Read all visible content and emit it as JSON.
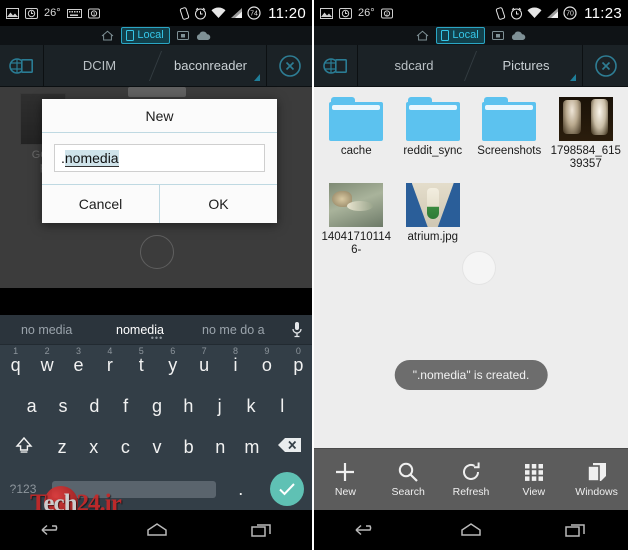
{
  "left_phone": {
    "status_bar": {
      "icons_left": [
        "gallery-icon",
        "camera-timer-icon",
        "keyboard-icon",
        "screenshot-icon"
      ],
      "temperature": "26°",
      "icons_right": [
        "vibrate-icon",
        "alarm-icon",
        "wifi-icon",
        "signal-icon",
        "battery-icon"
      ],
      "battery_level": "74",
      "time": "11:20"
    },
    "tabstrip": {
      "home_icon": "home-icon",
      "local_label": "Local",
      "lan_icon": "lan-icon",
      "cloud_icon": "cloud-icon"
    },
    "breadcrumb": {
      "menu_icon": "panel-toggle-icon",
      "crumbs": [
        "DCIM",
        "baconreader"
      ],
      "close_icon": "close-icon"
    },
    "background_item": {
      "label_line1": "GQs",
      "label_line2": "p"
    },
    "dialog": {
      "title": "New",
      "input_value": ".nomedia",
      "input_prefix": ".",
      "input_selected": "nomedia",
      "cancel_label": "Cancel",
      "ok_label": "OK"
    },
    "keyboard": {
      "suggestions": [
        "no media",
        "nomedia",
        "no me do a"
      ],
      "active_suggestion": "nomedia",
      "mic_icon": "microphone-icon",
      "row1": [
        {
          "key": "q",
          "num": "1"
        },
        {
          "key": "w",
          "num": "2"
        },
        {
          "key": "e",
          "num": "3"
        },
        {
          "key": "r",
          "num": "4"
        },
        {
          "key": "t",
          "num": "5"
        },
        {
          "key": "y",
          "num": "6"
        },
        {
          "key": "u",
          "num": "7"
        },
        {
          "key": "i",
          "num": "8"
        },
        {
          "key": "o",
          "num": "9"
        },
        {
          "key": "p",
          "num": "0"
        }
      ],
      "row2": [
        "a",
        "s",
        "d",
        "f",
        "g",
        "h",
        "j",
        "k",
        "l"
      ],
      "row3": [
        "z",
        "x",
        "c",
        "v",
        "b",
        "n",
        "m"
      ],
      "shift_icon": "shift-icon",
      "backspace_icon": "backspace-icon",
      "symbols_label": "?123",
      "period_label": ".",
      "enter_icon": "checkmark-icon"
    },
    "navbar": {
      "back_icon": "back-icon",
      "home_icon": "home-icon",
      "recents_icon": "recents-icon"
    },
    "watermark": {
      "text_prefix": "T",
      "text_rest": "ech",
      "text_suffix": "24.ir"
    }
  },
  "right_phone": {
    "status_bar": {
      "icons_left": [
        "gallery-icon",
        "camera-timer-icon",
        "screenshot-icon"
      ],
      "temperature": "26°",
      "icons_right": [
        "vibrate-icon",
        "alarm-icon",
        "wifi-icon",
        "signal-icon",
        "battery-icon"
      ],
      "battery_level": "70",
      "time": "11:23"
    },
    "tabstrip": {
      "home_icon": "home-icon",
      "local_label": "Local",
      "lan_icon": "lan-icon",
      "cloud_icon": "cloud-icon"
    },
    "breadcrumb": {
      "menu_icon": "panel-toggle-icon",
      "crumbs": [
        "sdcard",
        "Pictures"
      ],
      "close_icon": "close-icon"
    },
    "files": [
      {
        "name": "cache",
        "type": "folder"
      },
      {
        "name": "reddit_sync",
        "type": "folder"
      },
      {
        "name": "Screenshots",
        "type": "folder"
      },
      {
        "name": "1798584_61539357",
        "type": "image"
      },
      {
        "name": "140417101146-",
        "type": "image"
      },
      {
        "name": "atrium.jpg",
        "type": "image"
      }
    ],
    "toast": "\".nomedia\" is created.",
    "toolbar": [
      {
        "label": "New",
        "icon": "plus-icon"
      },
      {
        "label": "Search",
        "icon": "search-icon"
      },
      {
        "label": "Refresh",
        "icon": "refresh-icon"
      },
      {
        "label": "View",
        "icon": "grid-icon"
      },
      {
        "label": "Windows",
        "icon": "windows-icon"
      }
    ],
    "navbar": {
      "back_icon": "back-icon",
      "home_icon": "home-icon",
      "recents_icon": "recents-icon"
    }
  },
  "colors": {
    "accent_cyan": "#35c6e8",
    "folder_blue": "#5cc2ef",
    "enter_teal": "#5fc1b4",
    "keyboard_bg": "#333e47",
    "toolbar_gray": "#5c5c5c"
  }
}
